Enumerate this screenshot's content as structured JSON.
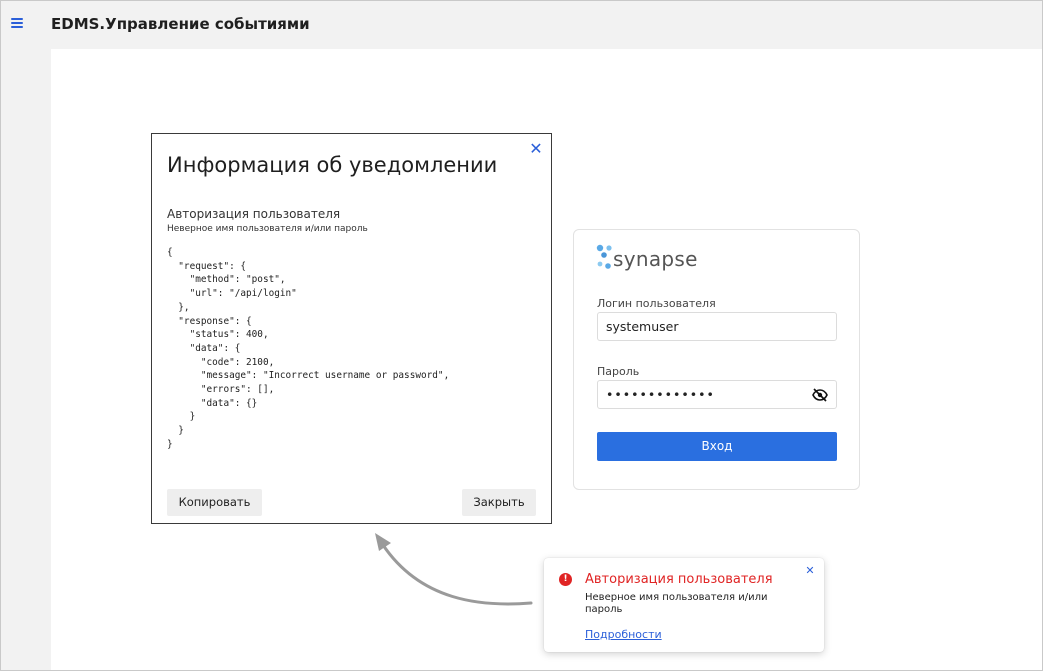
{
  "app": {
    "title": "EDMS.Управление событиями"
  },
  "dialog": {
    "title": "Информация об уведомлении",
    "subtitle": "Авторизация пользователя",
    "description": "Неверное имя пользователя и/или пароль",
    "code": "{\n  \"request\": {\n    \"method\": \"post\",\n    \"url\": \"/api/login\"\n  },\n  \"response\": {\n    \"status\": 400,\n    \"data\": {\n      \"code\": 2100,\n      \"message\": \"Incorrect username or password\",\n      \"errors\": [],\n      \"data\": {}\n    }\n  }\n}",
    "copy_label": "Копировать",
    "close_label": "Закрыть"
  },
  "login": {
    "logo_text": "synapse",
    "login_label": "Логин пользователя",
    "login_value": "systemuser",
    "password_label": "Пароль",
    "password_value": "•••••••••••••",
    "submit_label": "Вход"
  },
  "toast": {
    "title": "Авторизация пользователя",
    "message": "Неверное имя пользователя и/или пароль",
    "link_label": "Подробности"
  },
  "colors": {
    "accent": "#2a6fe0",
    "error": "#e02424",
    "chrome": "#f2f2f2"
  }
}
